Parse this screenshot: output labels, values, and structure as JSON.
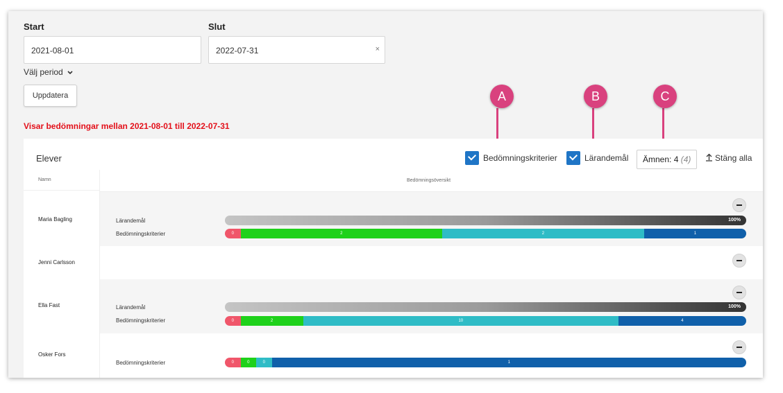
{
  "filters": {
    "start_label": "Start",
    "start_value": "2021-08-01",
    "end_label": "Slut",
    "end_value": "2022-07-31",
    "clear_icon": "×",
    "period_label": "Välj period",
    "update_label": "Uppdatera",
    "range_message": "Visar bedömningar mellan 2021-08-01 till 2022-07-31"
  },
  "panel": {
    "title": "Elever",
    "toggle_criteria_label": "Bedömningskriterier",
    "toggle_goals_label": "Lärandemål",
    "subjects_label": "Ämnen: 4",
    "subjects_count": "(4)",
    "close_all_label": "Stäng alla",
    "col_name_header": "Namn",
    "col_overview_header": "Bedömningsöversikt"
  },
  "colors": {
    "accent": "#1f75c6",
    "warning": "#e3101a",
    "marker": "#d9417e",
    "seg_red": "#f0566a",
    "seg_green": "#1fd11b",
    "seg_teal": "#2fbcc6",
    "seg_blue": "#1060aa"
  },
  "rows": [
    {
      "name": "Maria Bagling",
      "goal_label": "Lärandemål",
      "goal_pct": "100%",
      "criteria_label": "Bedömningskriterier",
      "segments": [
        {
          "value": "0",
          "share": 0.03,
          "color": "seg_red"
        },
        {
          "value": "2",
          "share": 0.387,
          "color": "seg_green"
        },
        {
          "value": "2",
          "share": 0.387,
          "color": "seg_teal"
        },
        {
          "value": "1",
          "share": 0.196,
          "color": "seg_blue"
        }
      ]
    },
    {
      "name": "Jenni Carlsson"
    },
    {
      "name": "Ella Fast",
      "goal_label": "Lärandemål",
      "goal_pct": "100%",
      "criteria_label": "Bedömningskriterier",
      "segments": [
        {
          "value": "0",
          "share": 0.03,
          "color": "seg_red"
        },
        {
          "value": "2",
          "share": 0.12,
          "color": "seg_green"
        },
        {
          "value": "10",
          "share": 0.605,
          "color": "seg_teal"
        },
        {
          "value": "4",
          "share": 0.245,
          "color": "seg_blue"
        }
      ]
    },
    {
      "name": "Osker Fors",
      "criteria_label": "Bedömningskriterier",
      "segments": [
        {
          "value": "0",
          "share": 0.03,
          "color": "seg_red"
        },
        {
          "value": "0",
          "share": 0.03,
          "color": "seg_green"
        },
        {
          "value": "0",
          "share": 0.03,
          "color": "seg_teal"
        },
        {
          "value": "1",
          "share": 0.91,
          "color": "seg_blue"
        }
      ]
    }
  ],
  "markers": {
    "a": "A",
    "b": "B",
    "c": "C"
  }
}
